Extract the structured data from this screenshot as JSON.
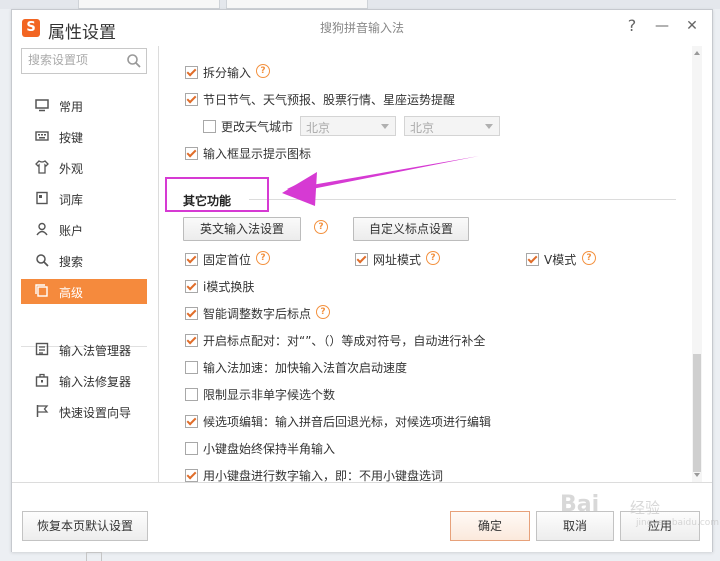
{
  "window": {
    "title": "属性设置",
    "app_name": "搜狗拼音输入法",
    "help_label": "?",
    "minimize_label": "—",
    "close_label": "✕"
  },
  "sidebar": {
    "search_placeholder": "搜索设置项",
    "items": [
      {
        "label": "常用",
        "icon": "monitor-icon"
      },
      {
        "label": "按键",
        "icon": "keyboard-icon"
      },
      {
        "label": "外观",
        "icon": "shirt-icon"
      },
      {
        "label": "词库",
        "icon": "book-icon"
      },
      {
        "label": "账户",
        "icon": "user-icon"
      },
      {
        "label": "搜索",
        "icon": "search-icon"
      },
      {
        "label": "高级",
        "icon": "advanced-icon",
        "active": true
      }
    ],
    "tools": [
      {
        "label": "输入法管理器",
        "icon": "manager-icon"
      },
      {
        "label": "输入法修复器",
        "icon": "toolbox-icon"
      },
      {
        "label": "快速设置向导",
        "icon": "flag-icon"
      }
    ]
  },
  "content": {
    "options_top": [
      {
        "label": "拆分输入",
        "checked": true,
        "help": true
      },
      {
        "label": "节日节气、天气预报、股票行情、星座运势提醒",
        "checked": true
      },
      {
        "label": "更改天气城市",
        "checked": false
      },
      {
        "label": "输入框显示提示图标",
        "checked": true
      }
    ],
    "city_selects": [
      "北京",
      "北京"
    ],
    "section_title": "其它功能",
    "buttons": {
      "english_settings": "英文输入法设置",
      "custom_punct": "自定义标点设置"
    },
    "row_options": [
      {
        "label": "固定首位",
        "checked": true,
        "help": true
      },
      {
        "label": "网址模式",
        "checked": true,
        "help": true
      },
      {
        "label": "V模式",
        "checked": true,
        "help": true
      }
    ],
    "options_bottom": [
      {
        "label": "i模式换肤",
        "checked": true
      },
      {
        "label": "智能调整数字后标点",
        "checked": true,
        "help": true
      },
      {
        "label": "开启标点配对：对“”、（）等成对符号，自动进行补全",
        "checked": true
      },
      {
        "label": "输入法加速：加快输入法首次启动速度",
        "checked": false
      },
      {
        "label": "限制显示非单字候选个数",
        "checked": false
      },
      {
        "label": "候选项编辑：输入拼音后回退光标，对候选项进行编辑",
        "checked": true
      },
      {
        "label": "小键盘始终保持半角输入",
        "checked": false
      },
      {
        "label": "用小键盘进行数字输入，即：不用小键盘选词",
        "checked": true
      }
    ]
  },
  "footer": {
    "restore": "恢复本页默认设置",
    "ok": "确定",
    "cancel": "取消",
    "apply": "应用"
  },
  "watermark": {
    "brand": "Bai",
    "brand_cn": "经验",
    "url": "jingyan.baidu.com"
  },
  "colors": {
    "accent": "#f58a3d",
    "annotation": "#d63ad3"
  }
}
